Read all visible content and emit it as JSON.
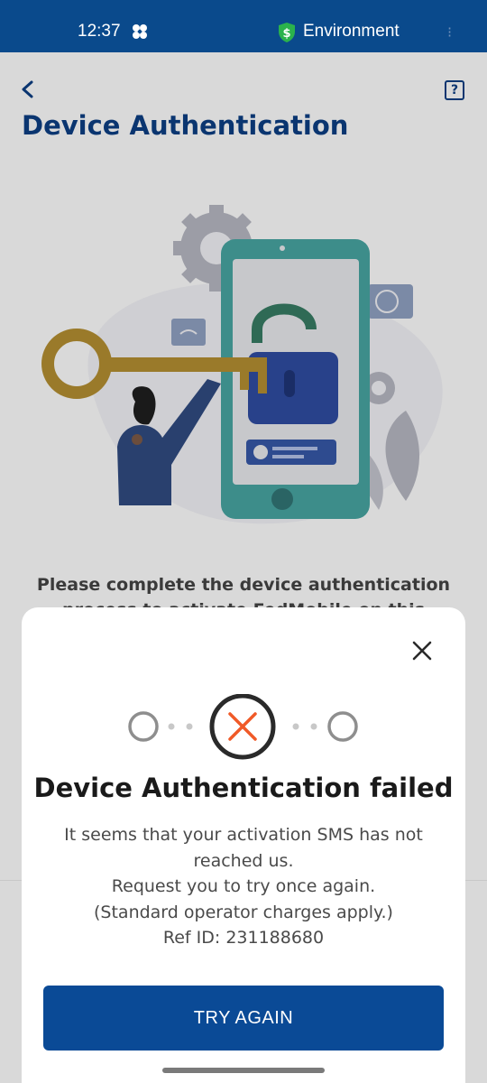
{
  "status_bar": {
    "time": "12:37",
    "carrier_label": "Environment"
  },
  "page": {
    "title": "Device Authentication",
    "instruction_lines": [
      "Please complete the device authentication",
      "process to activate FedMobile on this"
    ]
  },
  "modal": {
    "title": "Device Authentication failed",
    "message_lines": [
      "It seems that your activation SMS has not",
      "reached us.",
      "Request you to try once again.",
      "(Standard operator charges apply.)",
      "Ref ID: 231188680"
    ],
    "button_label": "TRY AGAIN",
    "progress_steps": [
      "pending",
      "failed",
      "pending"
    ]
  },
  "icons": {
    "back": "chevron-left-icon",
    "help": "question-mark-icon",
    "close": "close-icon",
    "error": "x-mark-icon"
  },
  "colors": {
    "brand_blue": "#0a4a96",
    "error_orange": "#f05a28",
    "status_bar": "#0a4a8c"
  }
}
